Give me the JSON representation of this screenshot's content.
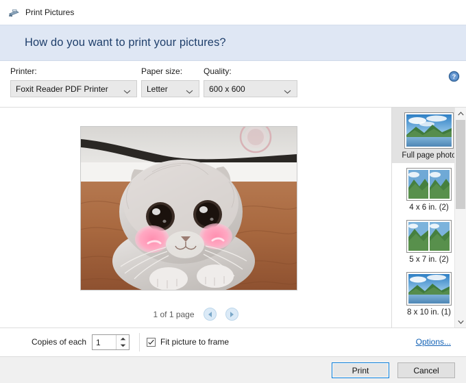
{
  "window": {
    "title": "Print Pictures",
    "icon": "printer-icon"
  },
  "heading": {
    "text": "How do you want to print your pictures?"
  },
  "settings": {
    "printer": {
      "label": "Printer:",
      "value": "Foxit Reader PDF Printer"
    },
    "paper_size": {
      "label": "Paper size:",
      "value": "Letter"
    },
    "quality": {
      "label": "Quality:",
      "value": "600 x 600"
    },
    "help_icon": "help-circle-icon"
  },
  "preview": {
    "image_alt": "Scottish Fold cat with pink blush cheeks lying on a brown blanket",
    "page_status": "1 of 1 page",
    "prev_icon": "chevron-left-circle-icon",
    "next_icon": "chevron-right-circle-icon"
  },
  "layouts": {
    "items": [
      {
        "label": "Full page photo",
        "selected": true,
        "tiles": 1,
        "orientation": "landscape"
      },
      {
        "label": "4 x 6 in. (2)",
        "selected": false,
        "tiles": 2,
        "orientation": "portrait"
      },
      {
        "label": "5 x 7 in. (2)",
        "selected": false,
        "tiles": 2,
        "orientation": "portrait"
      },
      {
        "label": "8 x 10 in. (1)",
        "selected": false,
        "tiles": 1,
        "orientation": "landscape"
      }
    ],
    "scroll_up_icon": "chevron-up-icon",
    "scroll_down_icon": "chevron-down-icon"
  },
  "options_bar": {
    "copies_label": "Copies of each",
    "copies_value": "1",
    "spin_up_icon": "spin-up-icon",
    "spin_down_icon": "spin-down-icon",
    "fit_picture_label": "Fit picture to frame",
    "fit_picture_checked": true,
    "options_link": "Options..."
  },
  "footer": {
    "print_label": "Print",
    "cancel_label": "Cancel"
  },
  "colors": {
    "heading_band": "#dfe7f4",
    "heading_text": "#1f3f6b",
    "link": "#1060b5",
    "focus_border": "#0078d7",
    "selected_row": "#e2e2e2"
  }
}
